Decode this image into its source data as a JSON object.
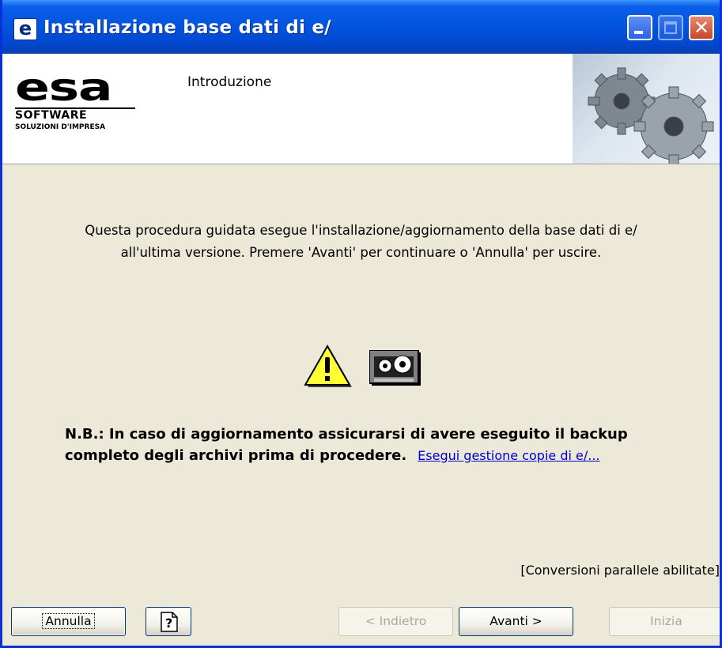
{
  "window": {
    "title": "Installazione base dati di e/",
    "icon": "e-app-icon",
    "app_icon_letter": "e"
  },
  "header": {
    "logo": {
      "top": "esa",
      "middle": "SOFTWARE",
      "bottom": "SOLUZIONI D'IMPRESA"
    },
    "title": "Introduzione",
    "image": "gears-icon"
  },
  "body": {
    "intro_line1": "Questa procedura guidata esegue l'installazione/aggiornamento della base dati di e/",
    "intro_line2": "all'ultima versione. Premere 'Avanti' per continuare o 'Annulla' per uscire.",
    "icons": [
      "warning-icon",
      "backup-tape-icon"
    ],
    "note_line1": "N.B.: In caso di aggiornamento assicurarsi di avere eseguito il backup",
    "note_line2": "completo degli archivi prima di procedere.",
    "link": "Esegui gestione copie di e/...",
    "status": "[Conversioni parallele abilitate]"
  },
  "buttons": {
    "cancel": "Annulla",
    "help_icon": "help-icon",
    "back": "< Indietro",
    "next": "Avanti >",
    "start": "Inizia"
  },
  "colors": {
    "titlebar": "#0355e0",
    "face": "#ece9d8",
    "link": "#0000cc",
    "disabled_text": "#aca899"
  }
}
